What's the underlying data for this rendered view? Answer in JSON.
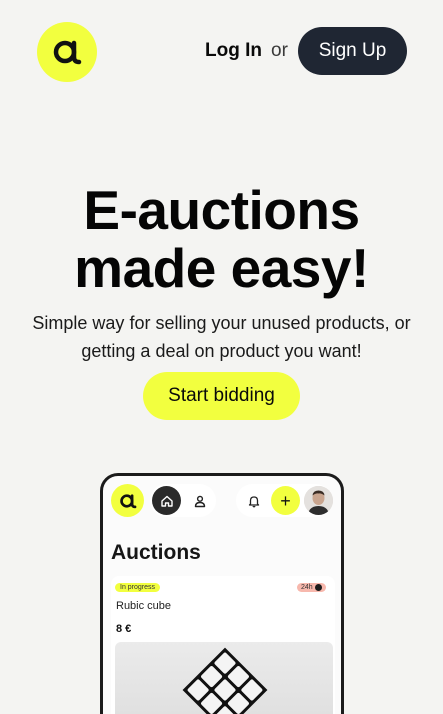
{
  "header": {
    "login_label": "Log In",
    "or_label": "or",
    "signup_label": "Sign Up"
  },
  "hero": {
    "title_line1": "E-auctions",
    "title_line2": "made easy!",
    "subtitle_line1": "Simple way for selling your unused products, or",
    "subtitle_line2": "getting a deal on product you want!",
    "cta_label": "Start bidding"
  },
  "preview": {
    "page_title": "Auctions",
    "card": {
      "status_badge": "In progress",
      "time_badge": "24h",
      "product_name": "Rubic cube",
      "price": "8 €"
    },
    "plus_label": "+"
  },
  "icons": {
    "logo": "logo-icon",
    "home": "home-icon",
    "user": "user-icon",
    "bell": "bell-icon",
    "plus": "plus-icon",
    "avatar": "avatar"
  },
  "colors": {
    "accent": "#f2ff3f",
    "dark_button": "#1f2633",
    "background": "#f4f4f2",
    "time_badge": "#f7b8ad"
  }
}
